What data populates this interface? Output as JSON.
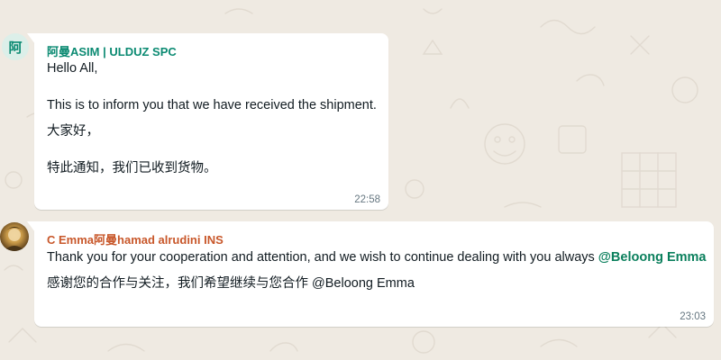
{
  "colors": {
    "chat_background": "#efeae2",
    "bubble_background": "#ffffff",
    "sender_1_color": "#0b8a72",
    "sender_2_color": "#c8572a",
    "mention_color": "#0a7f5c",
    "timestamp_color": "#667781"
  },
  "messages": [
    {
      "avatar_text": "阿",
      "sender": "阿曼ASIM | ULDUZ SPC",
      "lines": [
        "Hello All,",
        "This is to inform you that we have received the shipment.",
        "大家好，",
        "特此通知，我们已收到货物。"
      ],
      "time": "22:58"
    },
    {
      "avatar_icon": "profile-photo",
      "sender": "C Emma阿曼hamad alrudini INS",
      "line_1_text": "Thank you for your cooperation and attention, and we wish to continue dealing with you always ",
      "line_1_mention": "@Beloong Emma",
      "line_2": "感谢您的合作与关注，我们希望继续与您合作 @Beloong Emma",
      "time": "23:03"
    }
  ]
}
